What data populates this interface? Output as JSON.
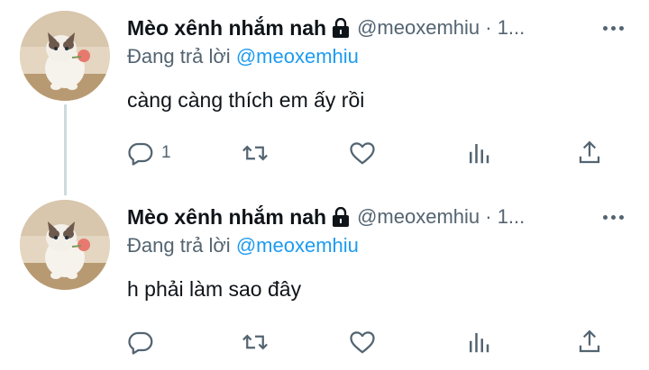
{
  "tweets": [
    {
      "author_name": "Mèo xênh nhắm nah",
      "handle": "@meoxemhiu · 1...",
      "reply_prefix": "Đang trả lời",
      "reply_to": "@meoxemhiu",
      "text": "càng càng thích em ấy rồi",
      "reply_count": "1"
    },
    {
      "author_name": "Mèo xênh nhắm nah",
      "handle": "@meoxemhiu · 1...",
      "reply_prefix": "Đang trả lời",
      "reply_to": "@meoxemhiu",
      "text": "h phải làm sao đây",
      "reply_count": ""
    }
  ],
  "icons": [
    "lock-icon",
    "more-icon",
    "reply-icon",
    "retweet-icon",
    "like-icon",
    "views-icon",
    "share-icon"
  ],
  "colors": {
    "accent": "#1d9bf0",
    "secondary_text": "#536471",
    "primary_text": "#0f1419",
    "thread_line": "#cfd9de"
  }
}
